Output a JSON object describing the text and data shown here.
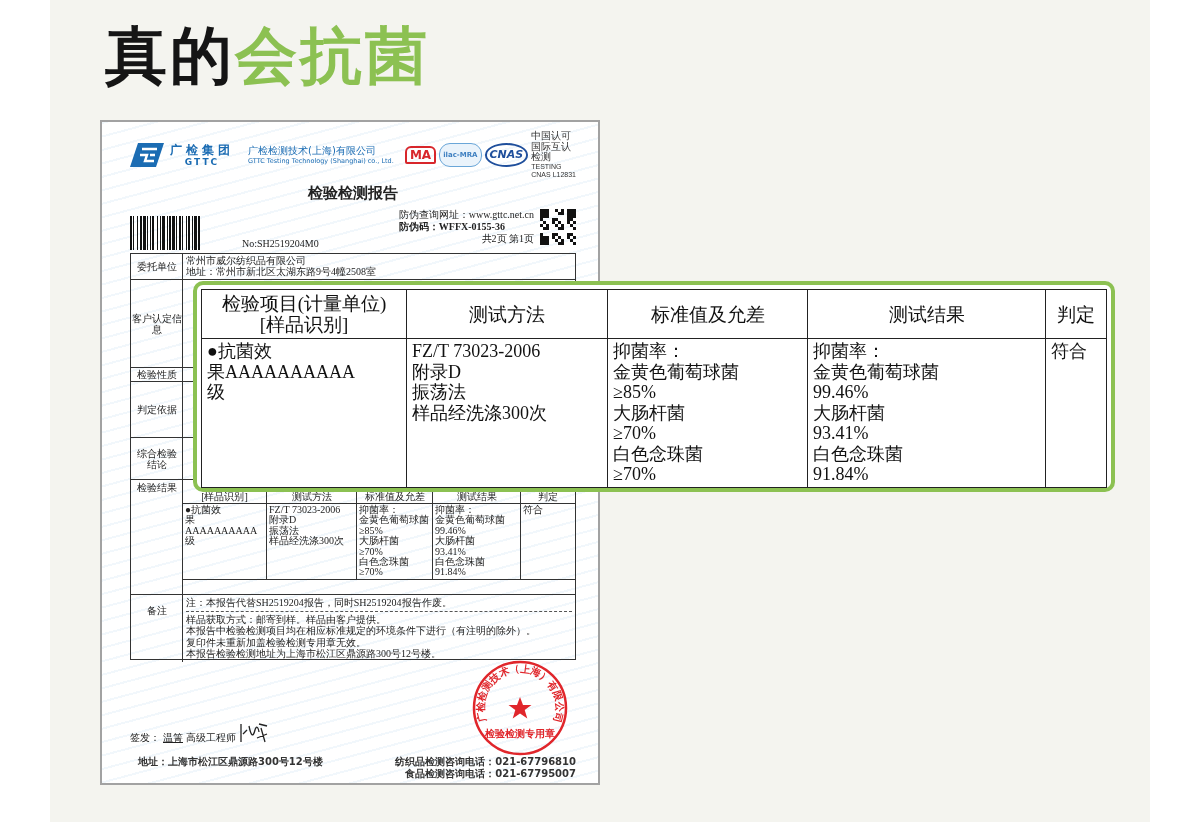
{
  "headline": [
    {
      "text": "真的",
      "kind": "plain"
    },
    {
      "text": "会抗菌",
      "kind": "accent"
    }
  ],
  "report": {
    "group_name": "广检集团",
    "group_code": "GTTC",
    "company_name": "广检检测技术(上海)有限公司",
    "company_name_en": "GTTC Testing Technology (Shanghai) co., Ltd.",
    "certifications": [
      {
        "kind": "cma",
        "label": "MA"
      },
      {
        "kind": "ilac",
        "label": "ilac-MRA"
      },
      {
        "kind": "cnas",
        "label": "CNAS"
      }
    ],
    "accreditation_lines": [
      "中国认可",
      "国际互认",
      "检测",
      "TESTING",
      "CNAS L12831"
    ],
    "title": "检验检测报告",
    "verify_url": "防伪查询网址：www.gttc.net.cn",
    "verify_code": "防伪码：WFFX-0155-36",
    "report_no": "No:SH2519204M0",
    "pages": "共2页 第1页",
    "rows": [
      {
        "label": [
          "委托单位"
        ],
        "content": [
          "常州市威尔纺织品有限公司",
          "地址：常州市新北区太湖东路9号4幢2508室"
        ]
      },
      {
        "label": [
          "客户认定信",
          "息"
        ]
      },
      {
        "label": [
          "检验性质"
        ]
      },
      {
        "label": [
          "判定依据"
        ]
      },
      {
        "label": [
          "综合检验",
          "结论"
        ]
      }
    ],
    "results": {
      "label": "检验结果",
      "columns": [
        {
          "lines": [
            "[样品识别]"
          ]
        },
        {
          "lines": [
            "测试方法"
          ]
        },
        {
          "lines": [
            "标准值及允差"
          ]
        },
        {
          "lines": [
            "测试结果"
          ]
        },
        {
          "lines": [
            "判定"
          ]
        }
      ],
      "rows": [
        [
          {
            "lines": [
              "●抗菌效",
              "果AAAAAAAAAA",
              "级"
            ]
          },
          {
            "lines": [
              "FZ/T 73023-2006",
              "附录D",
              "振荡法",
              "样品经洗涤300次"
            ]
          },
          {
            "lines": [
              "抑菌率：",
              "金黄色葡萄球菌",
              "≥85%",
              "大肠杆菌",
              "≥70%",
              "白色念珠菌",
              "≥70%"
            ]
          },
          {
            "lines": [
              "抑菌率：",
              "金黄色葡萄球菌",
              "99.46%",
              "大肠杆菌",
              "93.41%",
              "白色念珠菌",
              "91.84%"
            ]
          },
          {
            "lines": [
              "符合"
            ]
          }
        ]
      ]
    },
    "remarks": {
      "label": "备注",
      "note": "注：本报告代替SH2519204报告，同时SH2519204报告作废。",
      "lines": [
        "样品获取方式：邮寄到样。样品由客户提供。",
        "本报告中检验检测项目均在相应标准规定的环境条件下进行（有注明的除外）。",
        "复印件未重新加盖检验检测专用章无效。",
        "本报告检验检测地址为上海市松江区鼎源路300号12号楼。"
      ]
    },
    "signer": {
      "label": "签发：",
      "name": "温箐",
      "title": "高级工程师"
    },
    "seal": {
      "arc_text": "广检检测技术（上海）有限公司",
      "bottom_text": "检验检测专用章"
    },
    "footer": {
      "address": "地址：上海市松江区鼎源路300号12号楼",
      "phones": [
        "纺织品检测咨询电话：021-67796810",
        "食品检测咨询电话：021-67795007"
      ]
    }
  },
  "highlight_table": {
    "columns": [
      {
        "lines": [
          "检验项目(计量单位)",
          "[样品识别]"
        ]
      },
      {
        "lines": [
          "测试方法"
        ]
      },
      {
        "lines": [
          "标准值及允差"
        ]
      },
      {
        "lines": [
          "测试结果"
        ]
      },
      {
        "lines": [
          "判定"
        ]
      }
    ],
    "rows": [
      [
        {
          "lines": [
            "●抗菌效",
            "果AAAAAAAAAA",
            "级"
          ]
        },
        {
          "lines": [
            "FZ/T 73023-2006",
            "附录D",
            "振荡法",
            "样品经洗涤300次"
          ]
        },
        {
          "lines": [
            "抑菌率：",
            "金黄色葡萄球菌",
            "≥85%",
            "大肠杆菌",
            "≥70%",
            "白色念珠菌",
            "≥70%"
          ]
        },
        {
          "lines": [
            "抑菌率：",
            "金黄色葡萄球菌",
            "99.46%",
            "大肠杆菌",
            "93.41%",
            "白色念珠菌",
            "91.84%"
          ]
        },
        {
          "lines": [
            "符合"
          ]
        }
      ]
    ]
  }
}
